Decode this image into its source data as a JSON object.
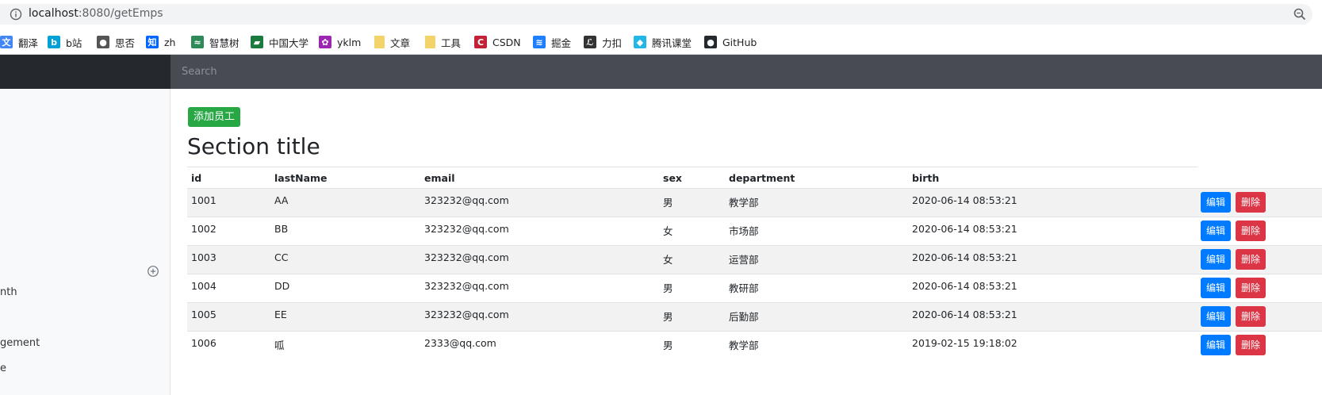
{
  "browser": {
    "url_host": "localhost",
    "url_path": ":8080/getEmps",
    "bookmarks": [
      {
        "label": "翻泽",
        "icon": "translate-icon",
        "color": "#4285f4"
      },
      {
        "label": "b站",
        "icon": "bilibili-icon",
        "color": "#00a1d6"
      },
      {
        "label": "思否",
        "icon": "globe-icon",
        "color": "#555555"
      },
      {
        "label": "zh",
        "icon": "zhihu-icon",
        "color": "#0066ff"
      },
      {
        "label": "智慧树",
        "icon": "zhihuishu-icon",
        "color": "#2e8b57"
      },
      {
        "label": "中国大学",
        "icon": "mooc-icon",
        "color": "#1b7a3e"
      },
      {
        "label": "yklm",
        "icon": "yklm-icon",
        "color": "#9c27b0"
      },
      {
        "label": "文章",
        "icon": "folder-icon",
        "color": "#f4d36b"
      },
      {
        "label": "工具",
        "icon": "folder-icon",
        "color": "#f4d36b"
      },
      {
        "label": "CSDN",
        "icon": "csdn-icon",
        "color": "#c32136"
      },
      {
        "label": "掘金",
        "icon": "juejin-icon",
        "color": "#1e80ff"
      },
      {
        "label": "力扣",
        "icon": "leetcode-icon",
        "color": "#333333"
      },
      {
        "label": "腾讯课堂",
        "icon": "tencent-class-icon",
        "color": "#23b7e5"
      },
      {
        "label": "GitHub",
        "icon": "github-icon",
        "color": "#24292e"
      }
    ]
  },
  "navbar": {
    "search_placeholder": "Search"
  },
  "sidebar": {
    "items": [
      "nth",
      "gement",
      "e"
    ]
  },
  "main": {
    "add_button": "添加员工",
    "section_title": "Section title",
    "table": {
      "headers": [
        "id",
        "lastName",
        "email",
        "sex",
        "department",
        "birth"
      ],
      "rows": [
        [
          "1001",
          "AA",
          "323232@qq.com",
          "男",
          "教学部",
          "2020-06-14 08:53:21"
        ],
        [
          "1002",
          "BB",
          "323232@qq.com",
          "女",
          "市场部",
          "2020-06-14 08:53:21"
        ],
        [
          "1003",
          "CC",
          "323232@qq.com",
          "女",
          "运营部",
          "2020-06-14 08:53:21"
        ],
        [
          "1004",
          "DD",
          "323232@qq.com",
          "男",
          "教研部",
          "2020-06-14 08:53:21"
        ],
        [
          "1005",
          "EE",
          "323232@qq.com",
          "男",
          "后勤部",
          "2020-06-14 08:53:21"
        ],
        [
          "1006",
          "呱",
          "2333@qq.com",
          "男",
          "教学部",
          "2019-02-15 19:18:02"
        ]
      ],
      "edit_label": "编辑",
      "delete_label": "删除"
    }
  },
  "colors": {
    "success": "#28a745",
    "primary": "#007bff",
    "danger": "#dc3545",
    "navbar": "#343a40"
  }
}
